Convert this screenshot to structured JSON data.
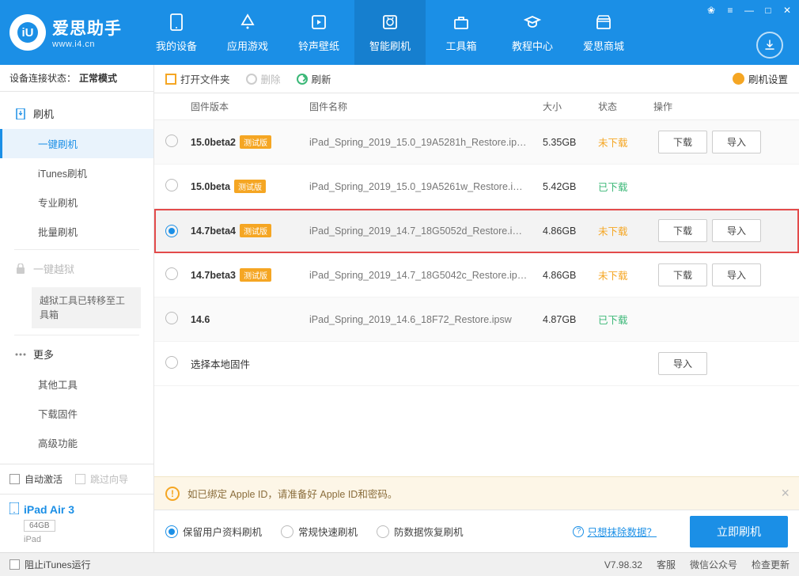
{
  "app": {
    "name": "爱思助手",
    "url": "www.i4.cn"
  },
  "win_controls": [
    "gift-icon",
    "menu-icon",
    "minimize-icon",
    "maximize-icon",
    "close-icon"
  ],
  "top_nav": [
    {
      "label": "我的设备",
      "icon": "device-icon"
    },
    {
      "label": "应用游戏",
      "icon": "apps-icon"
    },
    {
      "label": "铃声壁纸",
      "icon": "ringtone-icon"
    },
    {
      "label": "智能刷机",
      "icon": "flash-icon"
    },
    {
      "label": "工具箱",
      "icon": "toolbox-icon"
    },
    {
      "label": "教程中心",
      "icon": "tutorial-icon"
    },
    {
      "label": "爱思商城",
      "icon": "store-icon"
    }
  ],
  "top_nav_active": 3,
  "round_button": "download-circle-icon",
  "status": {
    "label": "设备连接状态：",
    "value": "正常模式"
  },
  "side": {
    "g1_head": "刷机",
    "g1_items": [
      "一键刷机",
      "iTunes刷机",
      "专业刷机",
      "批量刷机"
    ],
    "g1_active": 0,
    "jb_head": "一键越狱",
    "jb_note": "越狱工具已转移至工具箱",
    "g2_head": "更多",
    "g2_items": [
      "其他工具",
      "下载固件",
      "高级功能"
    ]
  },
  "side_foot": {
    "auto_activate": "自动激活",
    "skip_guide": "跳过向导"
  },
  "device": {
    "name": "iPad Air 3",
    "storage": "64GB",
    "type": "iPad",
    "icon": "ipad-icon"
  },
  "toolbar": {
    "open": "打开文件夹",
    "delete": "删除",
    "refresh": "刷新",
    "settings": "刷机设置"
  },
  "columns": {
    "version": "固件版本",
    "name": "固件名称",
    "size": "大小",
    "status": "状态",
    "ops": "操作"
  },
  "beta_tag": "测试版",
  "status_values": {
    "not_downloaded": "未下载",
    "downloaded": "已下载"
  },
  "ops": {
    "download": "下载",
    "import": "导入"
  },
  "rows": [
    {
      "sel": false,
      "ver": "15.0beta2",
      "beta": true,
      "name": "iPad_Spring_2019_15.0_19A5281h_Restore.ip…",
      "size": "5.35GB",
      "status": "not_downloaded",
      "ops": [
        "download",
        "import"
      ]
    },
    {
      "sel": false,
      "ver": "15.0beta",
      "beta": true,
      "name": "iPad_Spring_2019_15.0_19A5261w_Restore.i…",
      "size": "5.42GB",
      "status": "downloaded",
      "ops": []
    },
    {
      "sel": true,
      "ver": "14.7beta4",
      "beta": true,
      "name": "iPad_Spring_2019_14.7_18G5052d_Restore.i…",
      "size": "4.86GB",
      "status": "not_downloaded",
      "ops": [
        "download",
        "import"
      ],
      "highlight": true
    },
    {
      "sel": false,
      "ver": "14.7beta3",
      "beta": true,
      "name": "iPad_Spring_2019_14.7_18G5042c_Restore.ip…",
      "size": "4.86GB",
      "status": "not_downloaded",
      "ops": [
        "download",
        "import"
      ]
    },
    {
      "sel": false,
      "ver": "14.6",
      "beta": false,
      "name": "iPad_Spring_2019_14.6_18F72_Restore.ipsw",
      "size": "4.87GB",
      "status": "downloaded",
      "ops": []
    }
  ],
  "local_row": {
    "label": "选择本地固件",
    "op": "导入"
  },
  "warn": "如已绑定 Apple ID，请准备好 Apple ID和密码。",
  "modes": [
    "保留用户资料刷机",
    "常规快速刷机",
    "防数据恢复刷机"
  ],
  "mode_sel": 0,
  "erase_link": "只想抹除数据？",
  "flash_btn": "立即刷机",
  "footer": {
    "block_itunes": "阻止iTunes运行",
    "version": "V7.98.32",
    "links": [
      "客服",
      "微信公众号",
      "检查更新"
    ]
  }
}
